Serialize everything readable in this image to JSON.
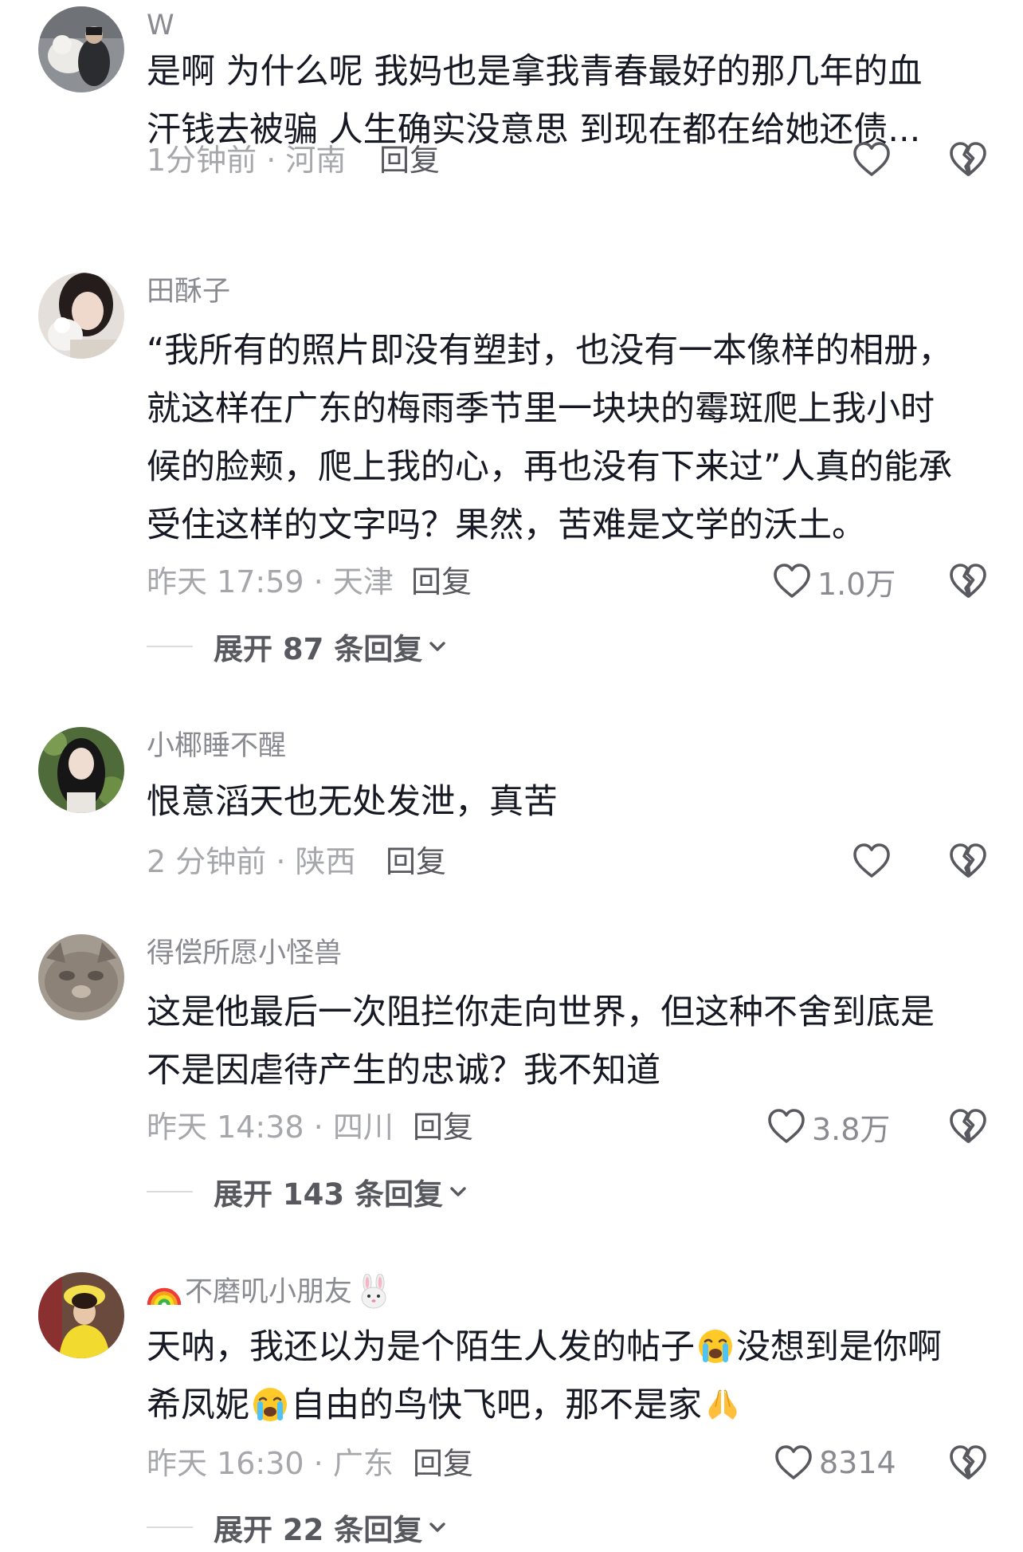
{
  "comments": [
    {
      "username": "W",
      "lines": [
        "是啊  为什么呢  我妈也是拿我青春最好的那几年的血",
        "汗钱去被骗  人生确实没意思  到现在都在给她还债..."
      ],
      "meta": "1分钟前 · 河南",
      "reply": "回复",
      "likes": ""
    },
    {
      "username": "田酥子",
      "lines": [
        "“我所有的照片即没有塑封，也没有一本像样的相册，",
        "就这样在广东的梅雨季节里一块块的霉斑爬上我小时",
        "候的脸颊，爬上我的心，再也没有下来过”人真的能承",
        "受住这样的文字吗？果然，苦难是文学的沃土。"
      ],
      "meta": "昨天 17:59 · 天津",
      "reply": "回复",
      "likes": "1.0万",
      "expand": "展开 87 条回复"
    },
    {
      "username": "小椰睡不醒",
      "lines": [
        "恨意滔天也无处发泄，真苦"
      ],
      "meta": "2 分钟前 · 陕西",
      "reply": "回复",
      "likes": ""
    },
    {
      "username": "得偿所愿小怪兽",
      "lines": [
        "这是他最后一次阻拦你走向世界，但这种不舍到底是",
        "不是因虐待产生的忠诚？我不知道"
      ],
      "meta": "昨天 14:38 · 四川",
      "reply": "回复",
      "likes": "3.8万",
      "expand": "展开 143 条回复"
    },
    {
      "username": "不磨叽小朋友",
      "line1a": "天呐，我还以为是个陌生人发的帖子",
      "line1b": "没想到是你啊",
      "line2a": "希凤妮",
      "line2b": "自由的鸟快飞吧，那不是家",
      "meta": "昨天 16:30 · 广东",
      "reply": "回复",
      "likes": "8314",
      "expand": "展开 22 条回复"
    }
  ],
  "icons": {
    "like": "heart-outline-icon",
    "dislike": "broken-heart-icon",
    "expand": "chevron-down-icon",
    "rainbow": "rainbow-emoji",
    "rabbit": "rabbit-face-emoji",
    "crying": "loudly-crying-emoji",
    "pray": "folded-hands-emoji"
  },
  "colors": {
    "text": "#161823",
    "username": "#8a8b91",
    "meta": "#a6a7ab",
    "action": "#58595f"
  }
}
